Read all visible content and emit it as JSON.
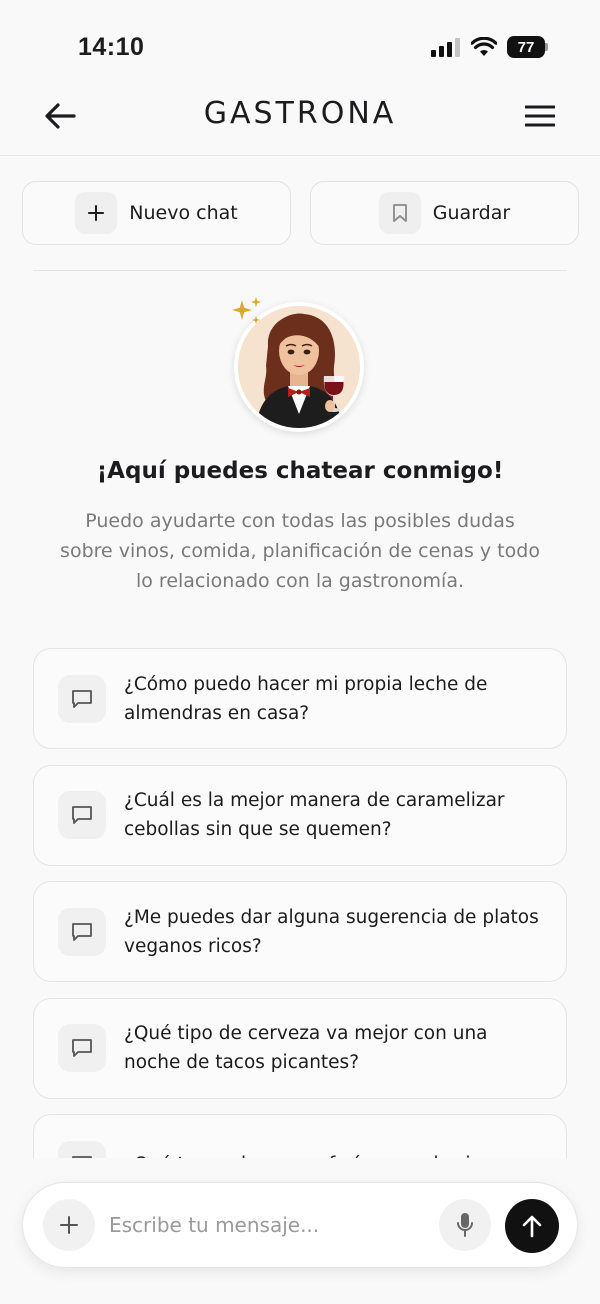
{
  "status_bar": {
    "time": "14:10",
    "battery": "77"
  },
  "header": {
    "brand": "GASTRONA",
    "back_icon": "arrow-left-icon",
    "menu_icon": "hamburger-menu-icon"
  },
  "actions": [
    {
      "label": "Nuevo chat",
      "icon": "plus-icon"
    },
    {
      "label": "Guardar",
      "icon": "bookmark-icon"
    }
  ],
  "assistant": {
    "avatar": "sommelier-avatar",
    "headline": "¡Aquí puedes chatear conmigo!",
    "subtitle": "Puedo ayudarte con todas las posibles dudas sobre vinos, comida, planificación de cenas y todo lo relacionado con la gastronomía."
  },
  "suggestions": [
    {
      "text": "¿Cómo puedo hacer mi propia leche de almendras en casa?"
    },
    {
      "text": "¿Cuál es la mejor manera de caramelizar cebollas sin que se quemen?"
    },
    {
      "text": "¿Me puedes dar alguna sugerencia de platos veganos ricos?"
    },
    {
      "text": "¿Qué tipo de cerveza va mejor con una noche de tacos picantes?"
    },
    {
      "text": "¿Qué trucos hay para freír pescado sin"
    }
  ],
  "composer": {
    "placeholder": "Escribe tu mensaje...",
    "value": ""
  },
  "colors": {
    "background": "#f9f9f9",
    "send_button": "#111111",
    "sparkle": "#d9a933"
  }
}
